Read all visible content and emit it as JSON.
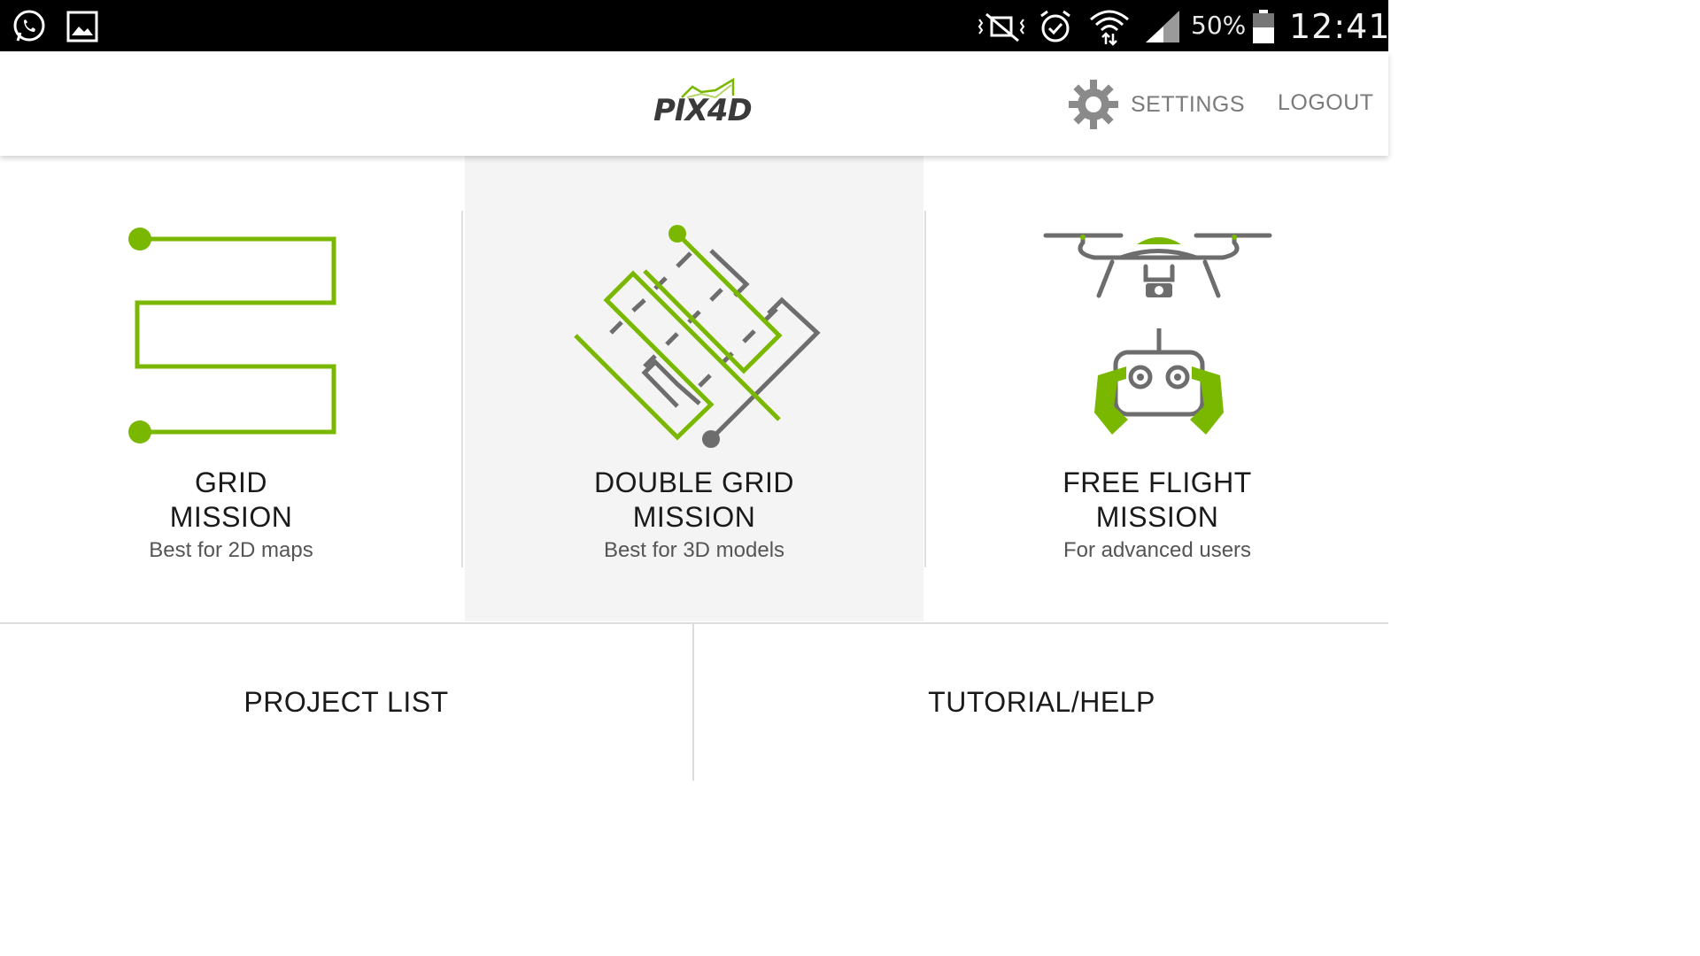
{
  "status_bar": {
    "icons": [
      "whatsapp-icon",
      "gallery-icon",
      "mute-icon",
      "alarm-icon",
      "wifi-icon",
      "signal-icon",
      "battery-icon"
    ],
    "battery": "50%",
    "time": "12:41"
  },
  "header": {
    "logo": "PIX4D",
    "settings_label": "SETTINGS",
    "logout_label": "LOGOUT"
  },
  "missions": [
    {
      "title_line1": "GRID",
      "title_line2": "MISSION",
      "subtitle": "Best for 2D maps",
      "icon": "grid-path-icon"
    },
    {
      "title_line1": "DOUBLE GRID",
      "title_line2": "MISSION",
      "subtitle": "Best for 3D models",
      "icon": "double-grid-path-icon"
    },
    {
      "title_line1": "FREE FLIGHT",
      "title_line2": "MISSION",
      "subtitle": "For advanced users",
      "icon": "drone-remote-icon"
    }
  ],
  "bottom_nav": {
    "project_list": "PROJECT LIST",
    "tutorial_help": "TUTORIAL/HELP"
  },
  "colors": {
    "accent_green": "#7ab800",
    "icon_gray": "#6d6d6d",
    "selected_bg": "#f4f4f4"
  }
}
